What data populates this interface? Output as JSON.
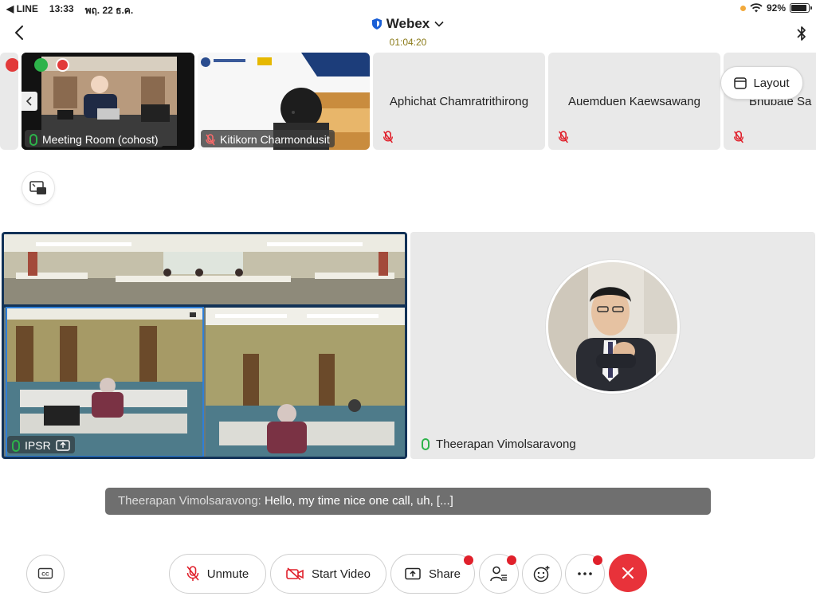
{
  "status_bar": {
    "back_app": "◀ LINE",
    "time": "13:33",
    "date": "พฤ. 22 ธ.ค.",
    "battery": "92%",
    "battery_level": 0.92
  },
  "header": {
    "title": "Webex",
    "timer": "01:04:20"
  },
  "participants": [
    {
      "name": "Meeting Room (cohost)"
    },
    {
      "name": "Kitikorn Charmondusit"
    },
    {
      "name": "Aphichat Chamratrithirong"
    },
    {
      "name": "Auemduen Kaewsawang"
    },
    {
      "name": "Bhubate Sa"
    }
  ],
  "layout_button": {
    "label": "Layout"
  },
  "main": {
    "left_label": "IPSR",
    "active_speaker": "Theerapan Vimolsaravong"
  },
  "caption": {
    "speaker": "Theerapan Vimolsaravong:",
    "text": " Hello, my time nice one call, uh, [...]"
  },
  "controls": {
    "unmute": "Unmute",
    "start_video": "Start Video",
    "share": "Share"
  },
  "colors": {
    "accent_green": "#2db34a",
    "end_red": "#e8323a",
    "notif_red": "#e0202b",
    "active_border": "#123257"
  }
}
